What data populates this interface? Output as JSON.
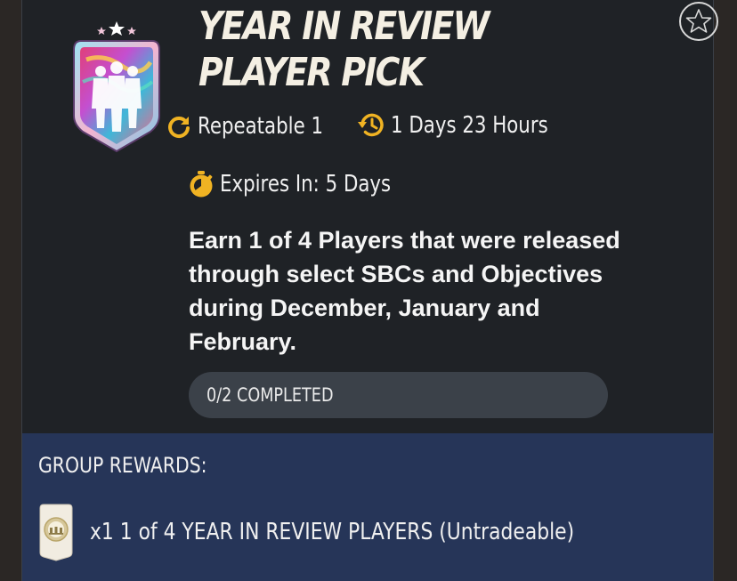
{
  "objective": {
    "title": "YEAR IN REVIEW PLAYER PICK",
    "repeatable": "Repeatable 1",
    "refresh_time": "1 Days 23 Hours",
    "expires": "Expires In: 5 Days",
    "description": "Earn 1 of 4 Players that were released through select SBCs and Objectives during December, January and February.",
    "progress": "0/2 COMPLETED",
    "progress_value": 0
  },
  "rewards": {
    "heading": "GROUP REWARDS:",
    "items": [
      {
        "label": "x1 1 of 4 YEAR IN REVIEW PLAYERS (Untradeable)",
        "icon": "player-pick-card-icon"
      }
    ]
  },
  "icons": {
    "favorite": "star-outline-icon",
    "repeatable": "refresh-icon",
    "refresh_time": "history-clock-icon",
    "expires": "stopwatch-icon",
    "badge": "year-in-review-badge"
  },
  "colors": {
    "accent": "#f0b323",
    "card_bg": "#1f2226",
    "rewards_bg": "#263558",
    "progress_bg": "#3b4149",
    "title": "#f4efe3"
  }
}
